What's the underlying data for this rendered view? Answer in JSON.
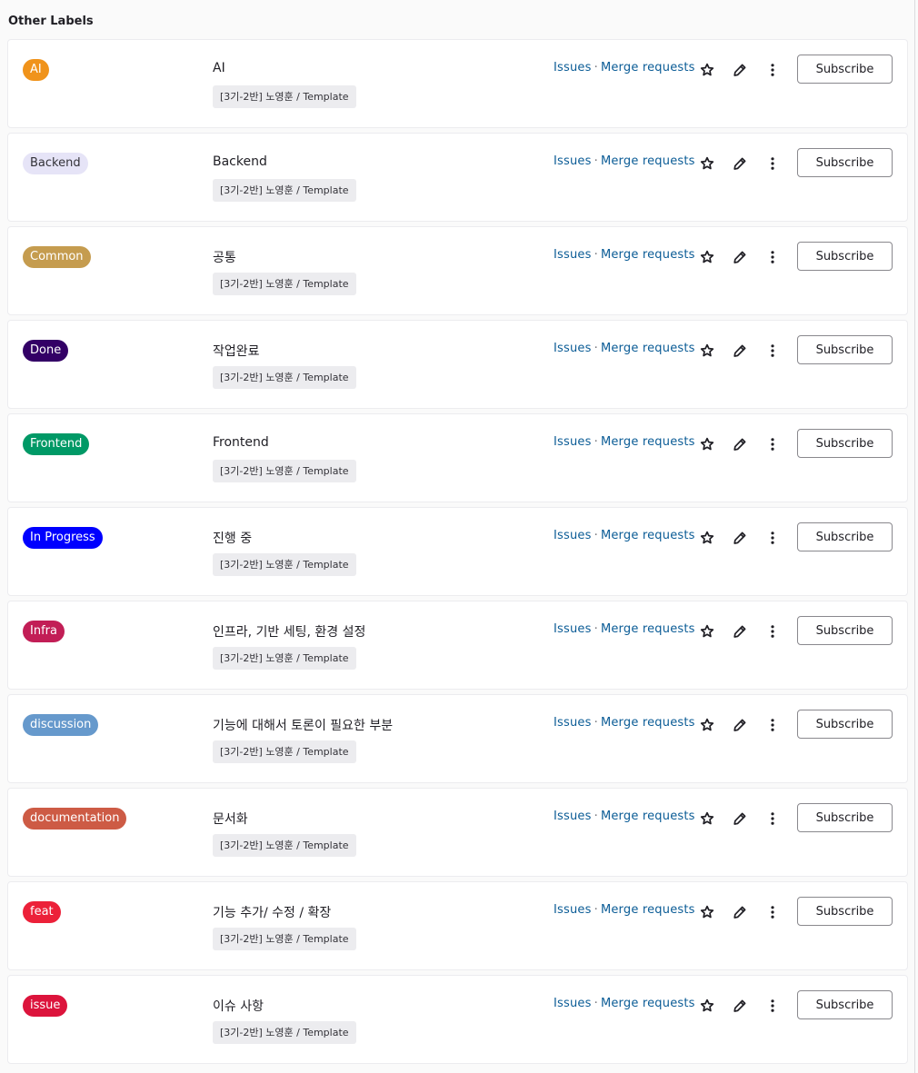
{
  "section_title": "Other Labels",
  "common": {
    "issues_label": "Issues",
    "separator": "·",
    "merge_requests_label": "Merge requests",
    "subscribe_label": "Subscribe"
  },
  "labels": [
    {
      "name": "AI",
      "description": "AI",
      "scope": "[3기-2반] 노영훈 / Template",
      "color": "#f0931b",
      "text_color": "#ffffff"
    },
    {
      "name": "Backend",
      "description": "Backend",
      "scope": "[3기-2반] 노영훈 / Template",
      "color": "#e6e4f7",
      "text_color": "#333238"
    },
    {
      "name": "Common",
      "description": "공통",
      "scope": "[3기-2반] 노영훈 / Template",
      "color": "#c59c4f",
      "text_color": "#ffffff"
    },
    {
      "name": "Done",
      "description": "작업완료",
      "scope": "[3기-2반] 노영훈 / Template",
      "color": "#330066",
      "text_color": "#ffffff"
    },
    {
      "name": "Frontend",
      "description": "Frontend",
      "scope": "[3기-2반] 노영훈 / Template",
      "color": "#009966",
      "text_color": "#ffffff"
    },
    {
      "name": "In Progress",
      "description": "진행 중",
      "scope": "[3기-2반] 노영훈 / Template",
      "color": "#0000ff",
      "text_color": "#ffffff"
    },
    {
      "name": "Infra",
      "description": "인프라, 기반 세팅, 환경 설정",
      "scope": "[3기-2반] 노영훈 / Template",
      "color": "#c21e56",
      "text_color": "#ffffff"
    },
    {
      "name": "discussion",
      "description": "기능에 대해서 토론이 필요한 부분",
      "scope": "[3기-2반] 노영훈 / Template",
      "color": "#6699cc",
      "text_color": "#ffffff"
    },
    {
      "name": "documentation",
      "description": "문서화",
      "scope": "[3기-2반] 노영훈 / Template",
      "color": "#cd5b45",
      "text_color": "#ffffff"
    },
    {
      "name": "feat",
      "description": "기능 추가/ 수정 / 확장",
      "scope": "[3기-2반] 노영훈 / Template",
      "color": "#ec2139",
      "text_color": "#ffffff"
    },
    {
      "name": "issue",
      "description": "이슈 사항",
      "scope": "[3기-2반] 노영훈 / Template",
      "color": "#dc143c",
      "text_color": "#ffffff"
    }
  ],
  "icons": {
    "star": "star-icon",
    "edit": "pencil-icon",
    "more": "vertical-ellipsis-icon"
  }
}
